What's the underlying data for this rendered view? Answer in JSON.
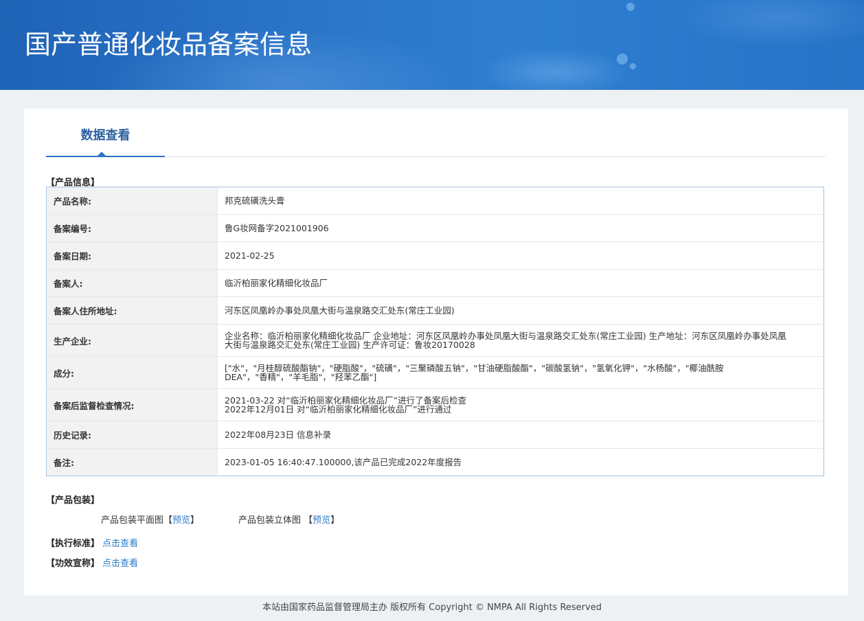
{
  "header": {
    "title": "国产普通化妆品备案信息"
  },
  "tabs": [
    {
      "label": "数据查看",
      "active": true
    }
  ],
  "product_info": {
    "section_title": "【产品信息】",
    "rows": [
      {
        "label": "产品名称:",
        "value": "邦克硫磺洗头膏"
      },
      {
        "label": "备案编号:",
        "value": "鲁G妆网备字2021001906"
      },
      {
        "label": "备案日期:",
        "value": "2021-02-25"
      },
      {
        "label": "备案人:",
        "value": "临沂柏丽家化精细化妆品厂"
      },
      {
        "label": "备案人住所地址:",
        "value": "河东区凤凰岭办事处凤凰大街与温泉路交汇处东(常庄工业园)"
      },
      {
        "label": "生产企业:",
        "value": "企业名称：临沂柏丽家化精细化妆品厂 企业地址：河东区凤凰岭办事处凤凰大街与温泉路交汇处东(常庄工业园) 生产地址：河东区凤凰岭办事处凤凰大街与温泉路交汇处东(常庄工业园) 生产许可证：鲁妆20170028"
      },
      {
        "label": "成分:",
        "value": "[\"水\"，\"月桂醇硫酸酯钠\"，\"硬脂酸\"，\"硫磺\"，\"三聚磷酸五钠\"，\"甘油硬脂酸酯\"，\"碳酸氢钠\"，\"氢氧化钾\"，\"水杨酸\"，\"椰油酰胺DEA\"，\"香精\"，\"羊毛脂\"，\"羟苯乙酯\"]"
      },
      {
        "label": "备案后监督检查情况:",
        "value_lines": [
          "2021-03-22 对“临沂柏丽家化精细化妆品厂”进行了备案后检查",
          "2022年12月01日 对“临沂柏丽家化精细化妆品厂”进行通过"
        ]
      },
      {
        "label": "历史记录:",
        "value": "2022年08月23日 信息补录"
      },
      {
        "label": "备注:",
        "value": "2023-01-05 16:40:47.100000,该产品已完成2022年度报告"
      }
    ]
  },
  "packaging": {
    "section_title": "【产品包装】",
    "flat_label": "产品包装平面图",
    "flat_link": "预览",
    "solid_label": "产品包装立体图",
    "solid_link": "预览",
    "bracket_open": "【",
    "bracket_close": "】"
  },
  "standard": {
    "label": "【执行标准】",
    "link": "点击查看"
  },
  "efficacy": {
    "label": "【功效宣称】",
    "link": "点击查看"
  },
  "footer": {
    "text": "本站由国家药品监督管理局主办 版权所有 Copyright © NMPA All Rights Reserved"
  }
}
